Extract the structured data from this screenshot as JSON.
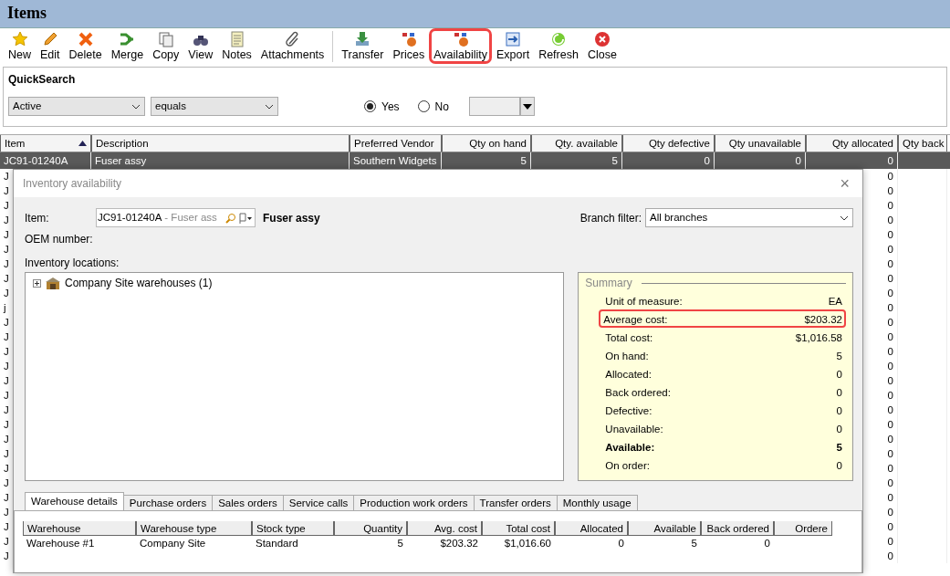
{
  "window": {
    "title": "Items"
  },
  "toolbar": {
    "groups": [
      [
        {
          "label": "New",
          "highlighted": false
        },
        {
          "label": "Edit",
          "highlighted": false
        },
        {
          "label": "Delete",
          "highlighted": false
        },
        {
          "label": "Merge",
          "highlighted": false
        },
        {
          "label": "Copy",
          "highlighted": false
        },
        {
          "label": "View",
          "highlighted": false
        },
        {
          "label": "Notes",
          "highlighted": false
        },
        {
          "label": "Attachments",
          "highlighted": false
        }
      ],
      [
        {
          "label": "Transfer",
          "highlighted": false
        },
        {
          "label": "Prices",
          "highlighted": false
        },
        {
          "label": "Availability",
          "highlighted": true
        },
        {
          "label": "Export",
          "highlighted": false
        },
        {
          "label": "Refresh",
          "highlighted": false
        },
        {
          "label": "Close",
          "highlighted": false
        }
      ]
    ]
  },
  "quicksearch": {
    "title": "QuickSearch",
    "field": "Active",
    "operator": "equals",
    "options": [
      {
        "label": "Yes",
        "selected": true
      },
      {
        "label": "No",
        "selected": false
      }
    ]
  },
  "grid": {
    "columns": [
      "Item",
      "Description",
      "Preferred Vendor",
      "Qty on hand",
      "Qty. available",
      "Qty defective",
      "Qty unavailable",
      "Qty allocated",
      "Qty back"
    ],
    "selected_row": [
      "JC91-01240A",
      "Fuser assy",
      "Southern Widgets",
      "5",
      "5",
      "0",
      "0",
      "0"
    ],
    "rows": [
      {
        "item": "J",
        "qty_allocated": "0"
      },
      {
        "item": "J",
        "qty_allocated": "0"
      },
      {
        "item": "J",
        "qty_allocated": "0"
      },
      {
        "item": "J",
        "qty_allocated": "0"
      },
      {
        "item": "J",
        "qty_allocated": "0"
      },
      {
        "item": "J",
        "qty_allocated": "0"
      },
      {
        "item": "J",
        "qty_allocated": "0"
      },
      {
        "item": "J",
        "qty_allocated": "0"
      },
      {
        "item": "J",
        "qty_allocated": "0"
      },
      {
        "item": "j",
        "qty_allocated": "0"
      },
      {
        "item": "J",
        "qty_allocated": "0"
      },
      {
        "item": "J",
        "qty_allocated": "0"
      },
      {
        "item": "J",
        "qty_allocated": "0"
      },
      {
        "item": "J",
        "qty_allocated": "0"
      },
      {
        "item": "J",
        "qty_allocated": "0"
      },
      {
        "item": "J",
        "qty_allocated": "0"
      },
      {
        "item": "J",
        "qty_allocated": "0"
      },
      {
        "item": "J",
        "qty_allocated": "0"
      },
      {
        "item": "J",
        "qty_allocated": "0"
      },
      {
        "item": "J",
        "qty_allocated": "0"
      },
      {
        "item": "J",
        "qty_allocated": "0"
      },
      {
        "item": "J",
        "qty_allocated": "0"
      },
      {
        "item": "J",
        "qty_allocated": "0"
      },
      {
        "item": "J",
        "qty_allocated": "0"
      },
      {
        "item": "J",
        "qty_allocated": "0"
      },
      {
        "item": "J",
        "qty_allocated": "0"
      },
      {
        "item": "J",
        "qty_allocated": "0"
      }
    ]
  },
  "dialog": {
    "title": "Inventory availability",
    "close_symbol": "×",
    "item_label": "Item:",
    "item_value": "JC91-01240A",
    "item_hint": "- Fuser ass",
    "item_description": "Fuser assy",
    "oem_label": "OEM number:",
    "branch_label": "Branch filter:",
    "branch_value": "All branches",
    "locations_label": "Inventory locations:",
    "locations": [
      {
        "label": "Company Site warehouses (1)",
        "expanded": false
      }
    ],
    "summary": {
      "title": "Summary",
      "rows": [
        {
          "label": "Unit of measure:",
          "value": "EA",
          "bold": false,
          "highlighted": false
        },
        {
          "label": "Average cost:",
          "value": "$203.32",
          "bold": false,
          "highlighted": true
        },
        {
          "label": "Total cost:",
          "value": "$1,016.58",
          "bold": false,
          "highlighted": false
        },
        {
          "label": "On hand:",
          "value": "5",
          "bold": false,
          "highlighted": false
        },
        {
          "label": "Allocated:",
          "value": "0",
          "bold": false,
          "highlighted": false
        },
        {
          "label": "Back ordered:",
          "value": "0",
          "bold": false,
          "highlighted": false
        },
        {
          "label": "Defective:",
          "value": "0",
          "bold": false,
          "highlighted": false
        },
        {
          "label": "Unavailable:",
          "value": "0",
          "bold": false,
          "highlighted": false
        },
        {
          "label": "Available:",
          "value": "5",
          "bold": true,
          "highlighted": false
        },
        {
          "label": "On order:",
          "value": "0",
          "bold": false,
          "highlighted": false
        }
      ]
    },
    "tabs": [
      {
        "label": "Warehouse details",
        "selected": true
      },
      {
        "label": "Purchase orders",
        "selected": false
      },
      {
        "label": "Sales orders",
        "selected": false
      },
      {
        "label": "Service calls",
        "selected": false
      },
      {
        "label": "Production work orders",
        "selected": false
      },
      {
        "label": "Transfer orders",
        "selected": false
      },
      {
        "label": "Monthly usage",
        "selected": false
      }
    ],
    "table": {
      "columns": [
        "Warehouse",
        "Warehouse type",
        "Stock type",
        "Quantity",
        "Avg. cost",
        "Total cost",
        "Allocated",
        "Available",
        "Back ordered",
        "Ordere"
      ],
      "rows": [
        [
          "Warehouse #1",
          "Company Site",
          "Standard",
          "5",
          "$203.32",
          "$1,016.60",
          "0",
          "5",
          "0"
        ]
      ]
    }
  }
}
